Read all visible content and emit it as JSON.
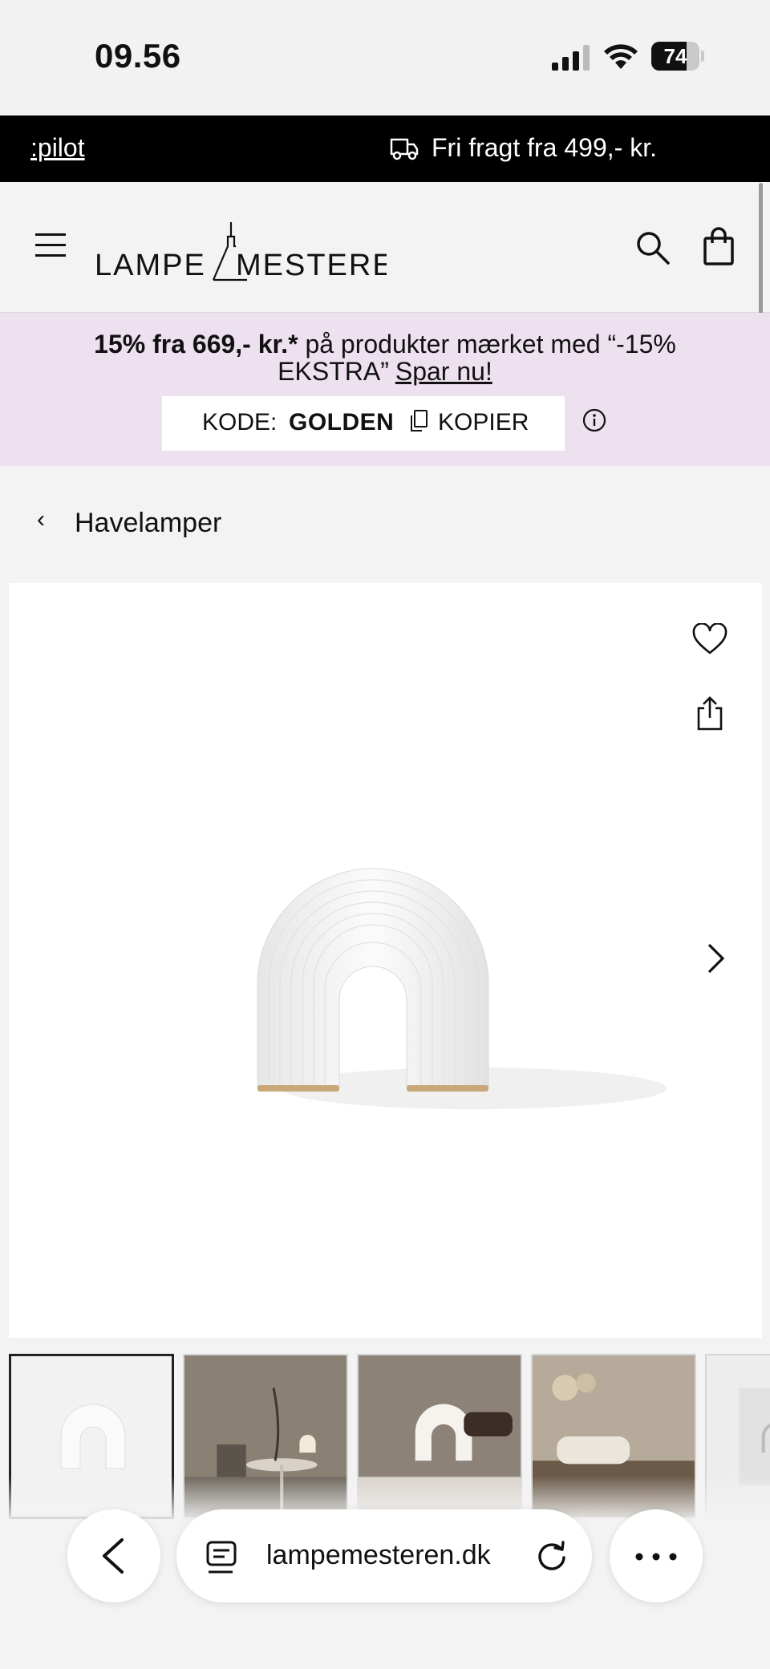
{
  "status_bar": {
    "time": "09.56",
    "battery": "74",
    "battery_level": 0.74
  },
  "ticker": {
    "left_text": ":pilot",
    "right_text": "Fri fragt fra 499,- kr."
  },
  "header": {
    "logo_left": "LAMPE",
    "logo_right": "MESTEREN"
  },
  "discount": {
    "bold": "15% fra 669,- kr.*",
    "text1": " på produkter mærket med “-15%",
    "text2": "EKSTRA”",
    "cta": "Spar nu!",
    "code_label": "KODE:",
    "code": "GOLDEN",
    "copy": "KOPIER"
  },
  "breadcrumb": {
    "chevron": "‹",
    "label": "Havelamper"
  },
  "browser": {
    "domain": "lampemesteren.dk"
  },
  "colors": {
    "ticker_bg": "#000000",
    "banner_bg": "#ede0ef",
    "page_bg": "#f3f3f3"
  }
}
